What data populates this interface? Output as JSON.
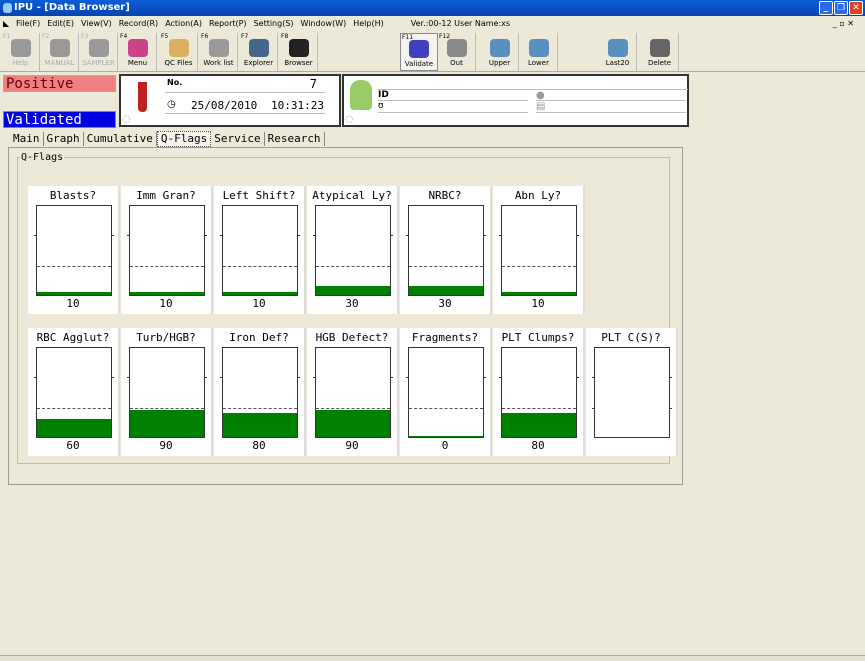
{
  "window": {
    "title": "IPU - [Data Browser]"
  },
  "menu": {
    "items": [
      "File(F)",
      "Edit(E)",
      "View(V)",
      "Record(R)",
      "Action(A)",
      "Report(P)",
      "Setting(S)",
      "Window(W)",
      "Help(H)"
    ],
    "version": "Ver.:00-12 User Name:xs"
  },
  "toolbar": [
    {
      "key": "F1",
      "label": "Help",
      "disabled": true,
      "color": "#999"
    },
    {
      "key": "F2",
      "label": "MANUAL",
      "disabled": true,
      "color": "#999"
    },
    {
      "key": "F3",
      "label": "SAMPLER",
      "disabled": true,
      "color": "#999"
    },
    {
      "key": "F4",
      "label": "Menu",
      "color": "#c48"
    },
    {
      "key": "F5",
      "label": "QC Files",
      "color": "#d8b060"
    },
    {
      "key": "F6",
      "label": "Work list",
      "color": "#999"
    },
    {
      "key": "F7",
      "label": "Explorer",
      "color": "#468"
    },
    {
      "key": "F8",
      "label": "Browser",
      "color": "#222"
    },
    {
      "key": "F11",
      "label": "Validate",
      "color": "#4040c0",
      "pressed": true
    },
    {
      "key": "F12",
      "label": "Out",
      "color": "#888"
    },
    {
      "key": "",
      "label": "Upper",
      "color": "#5b8fc0"
    },
    {
      "key": "",
      "label": "Lower",
      "color": "#5b8fc0"
    },
    {
      "key": "",
      "label": "Last20",
      "color": "#5b8fc0"
    },
    {
      "key": "",
      "label": "Delete",
      "color": "#666"
    }
  ],
  "status": {
    "positive": "Positive",
    "validated": "Validated"
  },
  "sample": {
    "no_label": "No.",
    "no": "7",
    "date": "25/08/2010",
    "time": "10:31:23"
  },
  "patient": {
    "id_label": "ID"
  },
  "tabs": [
    "Main",
    "Graph",
    "Cumulative",
    "Q-Flags",
    "Service",
    "Research"
  ],
  "active_tab": "Q-Flags",
  "group_label": "Q-Flags",
  "flag_max": 300,
  "flags_row1": [
    {
      "name": "Blasts?",
      "value": 10
    },
    {
      "name": "Imm Gran?",
      "value": 10
    },
    {
      "name": "Left Shift?",
      "value": 10
    },
    {
      "name": "Atypical Ly?",
      "value": 30
    },
    {
      "name": "NRBC?",
      "value": 30
    },
    {
      "name": "Abn Ly?",
      "value": 10
    }
  ],
  "flags_row2": [
    {
      "name": "RBC Agglut?",
      "value": 60
    },
    {
      "name": "Turb/HGB?",
      "value": 90
    },
    {
      "name": "Iron Def?",
      "value": 80
    },
    {
      "name": "HGB Defect?",
      "value": 90
    },
    {
      "name": "Fragments?",
      "value": 0
    },
    {
      "name": "PLT Clumps?",
      "value": 80
    },
    {
      "name": "PLT C(S)?",
      "value": null
    }
  ],
  "colors": {
    "bar": "#008000",
    "positive": "#f08080",
    "validated": "#0000e0"
  }
}
